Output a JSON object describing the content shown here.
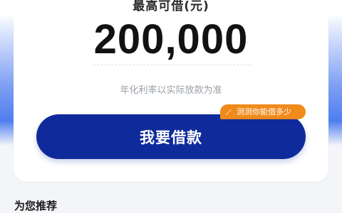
{
  "loan_card": {
    "max_label": "最高可借(元)",
    "amount": "200,000",
    "rate_note": "年化利率以实际放款为准",
    "button_label": "我要借款",
    "test_badge": "测测你能借多少"
  },
  "recommend": {
    "title": "为您推荐"
  },
  "colors": {
    "primary": "#0f2b9b",
    "badge": "#f08a1a",
    "background_blue": "#4f7ef0"
  },
  "icons": {
    "test_badge_icon": "pencil-icon"
  }
}
